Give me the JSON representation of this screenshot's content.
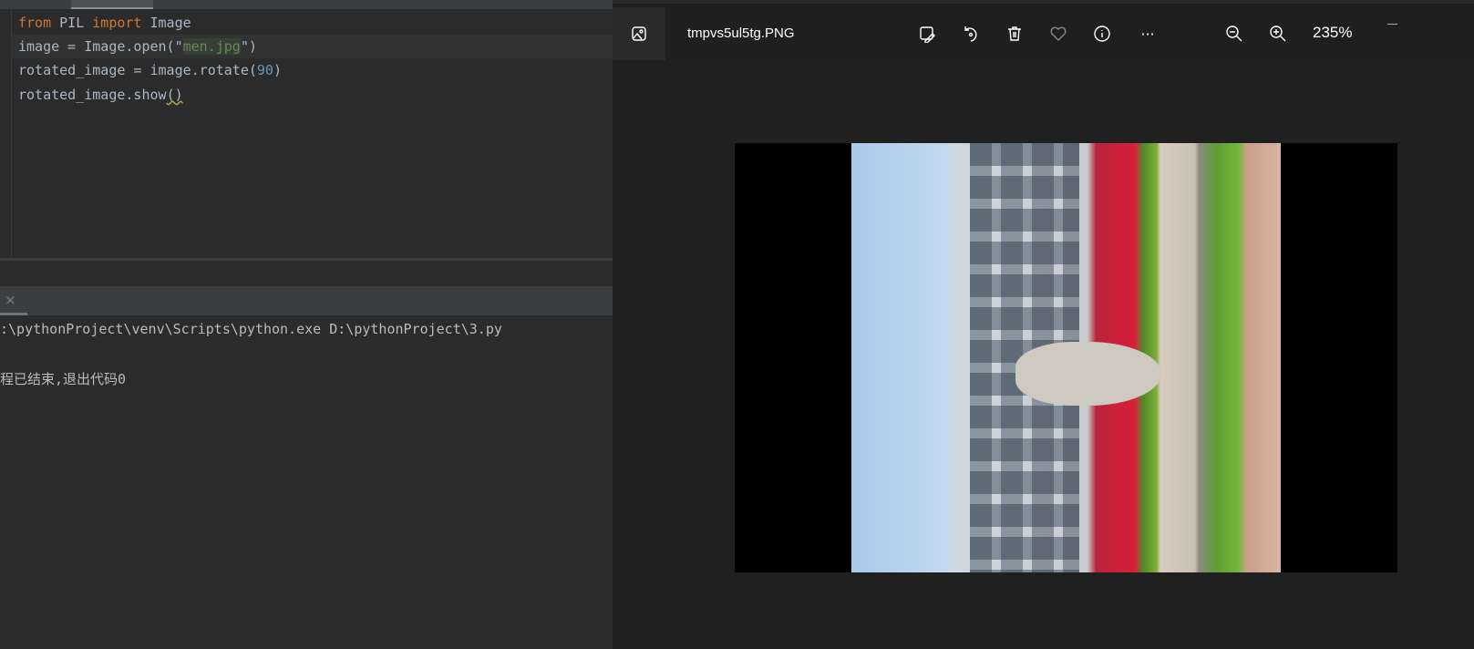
{
  "editor": {
    "lines": [
      {
        "kw1": "from",
        "t1": " PIL ",
        "kw2": "import",
        "t2": " Image"
      },
      {
        "t1": "image = Image.open(\"",
        "str": "men.jpg",
        "t2": "\")"
      },
      {
        "t1": "rotated_image = image.rotate(",
        "num": "90",
        "t2": ")"
      },
      {
        "t1": "rotated_image.show",
        "t2": "()"
      }
    ]
  },
  "console": {
    "close_icon": "×",
    "command": ":\\pythonProject\\venv\\Scripts\\python.exe D:\\pythonProject\\3.py",
    "exit_message": "程已结束,退出代码0"
  },
  "viewer": {
    "filename": "tmpvs5ul5tg.PNG",
    "zoom": "235%",
    "toolbar": [
      "edit-image-icon",
      "rotate-icon",
      "delete-icon",
      "favorite-icon",
      "info-icon",
      "more-icon",
      "zoom-out-icon",
      "zoom-in-icon"
    ],
    "more_label": "···"
  }
}
